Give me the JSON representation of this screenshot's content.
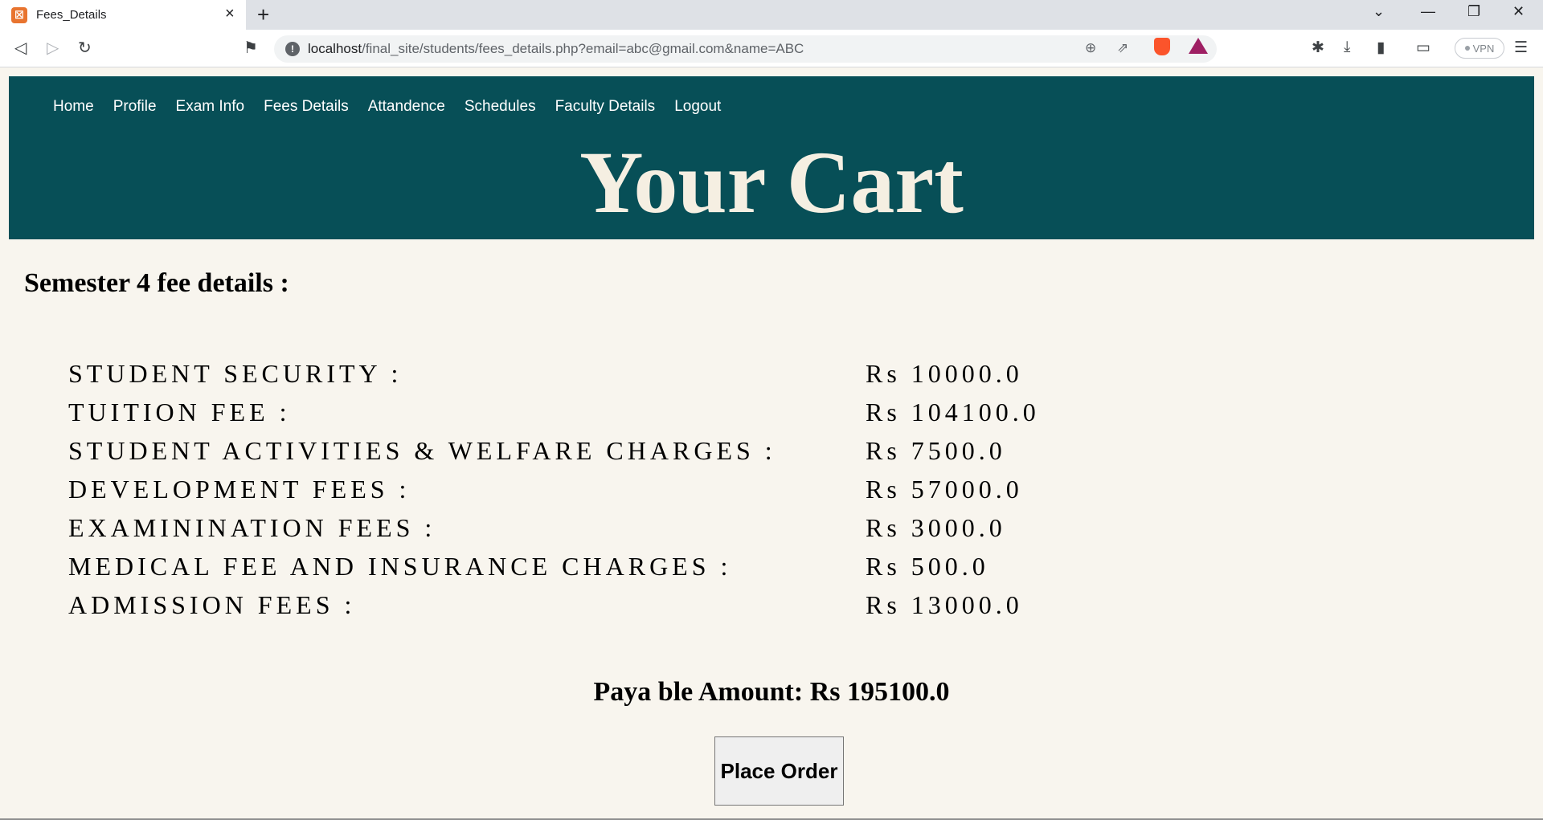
{
  "browser": {
    "tab_title": "Fees_Details",
    "url_host": "localhost",
    "url_path": "/final_site/students/fees_details.php?email=abc@gmail.com&name=ABC",
    "vpn_label": "VPN"
  },
  "nav": {
    "items": [
      "Home",
      "Profile",
      "Exam Info",
      "Fees Details",
      "Attandence",
      "Schedules",
      "Faculty Details",
      "Logout"
    ]
  },
  "header": {
    "title": "Your Cart"
  },
  "semester": {
    "title": "Semester 4 fee details :"
  },
  "fees": [
    {
      "label": "STUDENT SECURITY :",
      "amount": "Rs 10000.0"
    },
    {
      "label": "TUITION FEE :",
      "amount": "Rs 104100.0"
    },
    {
      "label": "STUDENT ACTIVITIES & WELFARE CHARGES :",
      "amount": "Rs 7500.0"
    },
    {
      "label": "DEVELOPMENT FEES :",
      "amount": "Rs 57000.0"
    },
    {
      "label": "EXAMININATION FEES :",
      "amount": "Rs 3000.0"
    },
    {
      "label": "MEDICAL FEE AND INSURANCE CHARGES :",
      "amount": "Rs 500.0"
    },
    {
      "label": "ADMISSION FEES :",
      "amount": "Rs 13000.0"
    }
  ],
  "payable": {
    "text": "Paya ble Amount: Rs 195100.0"
  },
  "actions": {
    "place_order": "Place Order"
  },
  "colors": {
    "header_bg": "#074f57",
    "page_bg": "#f8f5ee",
    "title_text": "#f5efe2"
  }
}
